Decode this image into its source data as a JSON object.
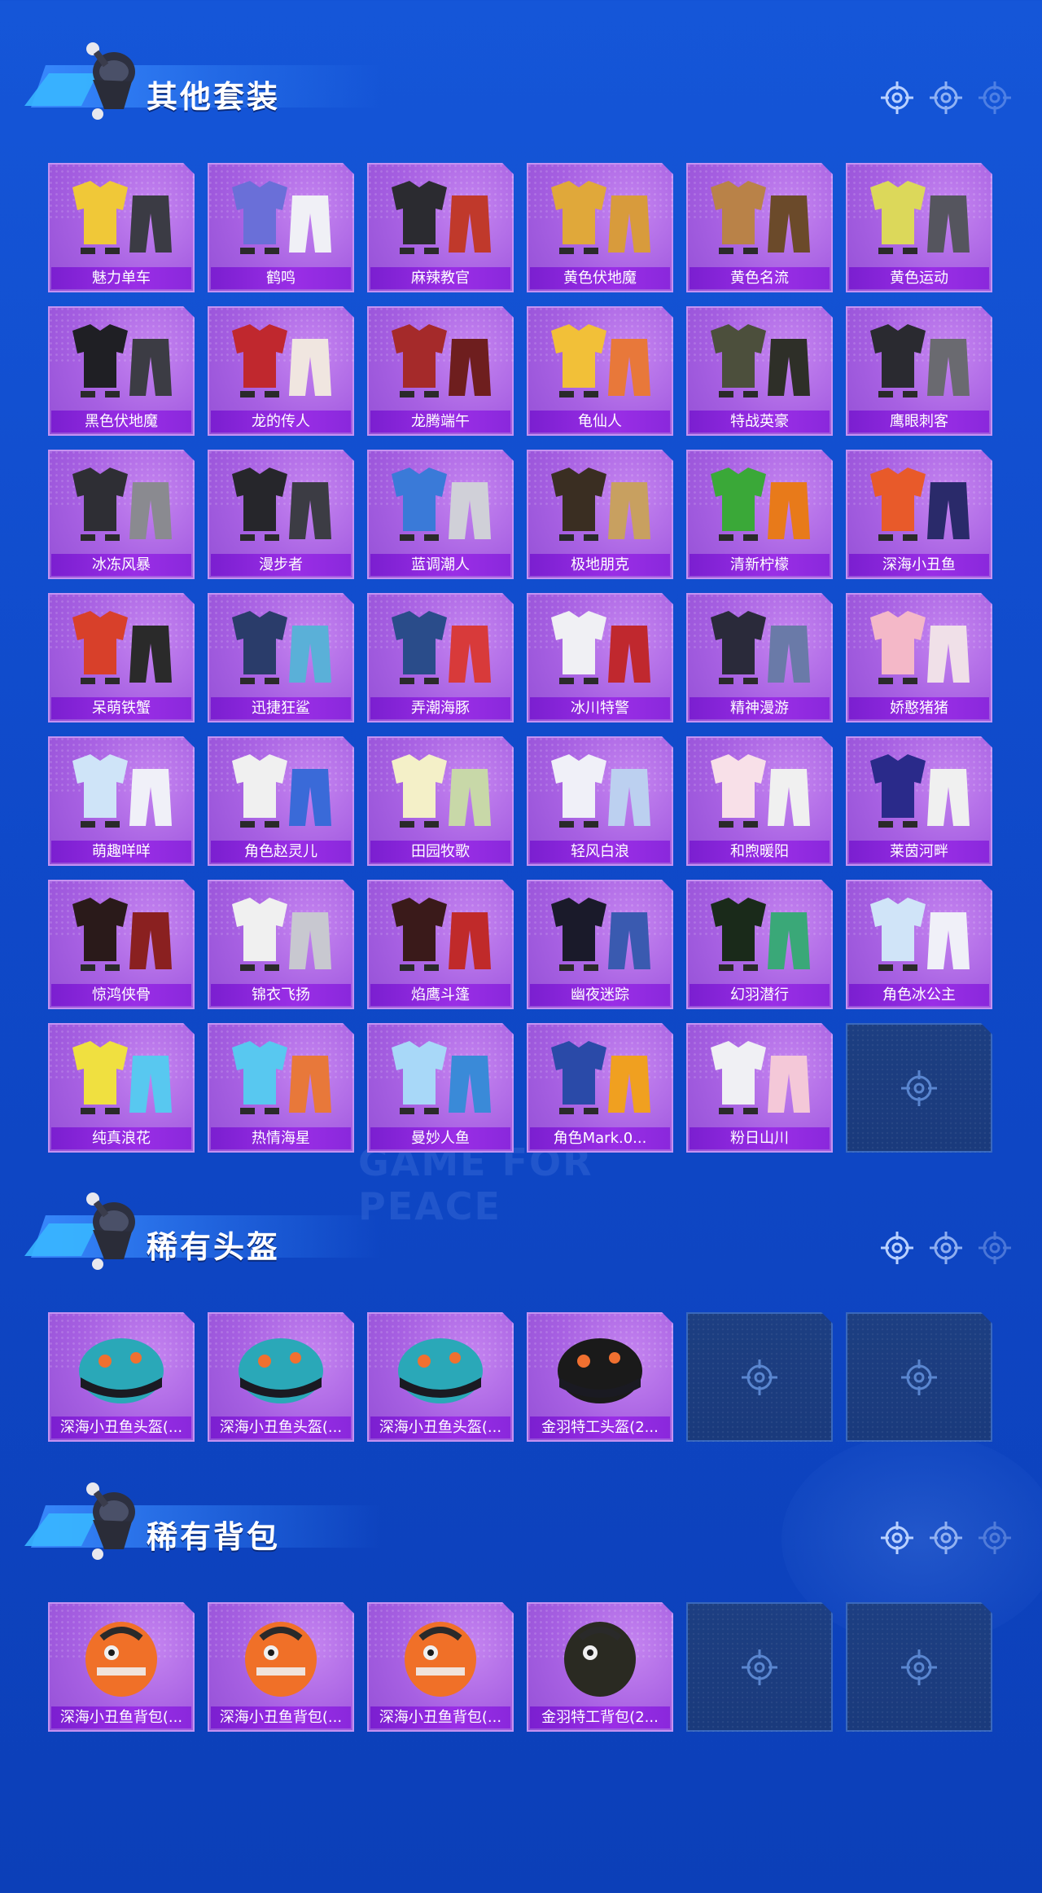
{
  "sections": [
    {
      "title": "其他套装",
      "items": [
        "魅力单车",
        "鹤鸣",
        "麻辣教官",
        "黄色伏地魔",
        "黄色名流",
        "黄色运动",
        "黑色伏地魔",
        "龙的传人",
        "龙腾端午",
        "龟仙人",
        "特战英豪",
        "鹰眼刺客",
        "冰冻风暴",
        "漫步者",
        "蓝调潮人",
        "极地朋克",
        "清新柠檬",
        "深海小丑鱼",
        "呆萌铁蟹",
        "迅捷狂鲨",
        "弄潮海豚",
        "冰川特警",
        "精神漫游",
        "娇憨猪猪",
        "萌趣咩咩",
        "角色赵灵儿",
        "田园牧歌",
        "轻风白浪",
        "和煦暖阳",
        "莱茵河畔",
        "惊鸿侠骨",
        "锦衣飞扬",
        "焰鹰斗篷",
        "幽夜迷踪",
        "幻羽潜行",
        "角色冰公主",
        "纯真浪花",
        "热情海星",
        "曼妙人鱼",
        "角色Mark.0...",
        "粉日山川"
      ],
      "empty_slots": 1
    },
    {
      "title": "稀有头盔",
      "items": [
        "深海小丑鱼头盔(...",
        "深海小丑鱼头盔(...",
        "深海小丑鱼头盔(...",
        "金羽特工头盔(2..."
      ],
      "empty_slots": 2
    },
    {
      "title": "稀有背包",
      "items": [
        "深海小丑鱼背包(...",
        "深海小丑鱼背包(...",
        "深海小丑鱼背包(...",
        "金羽特工背包(2..."
      ],
      "empty_slots": 2
    }
  ],
  "watermark": "GAME FOR PEACE",
  "colors": {
    "card_purple": "#a760e2",
    "label_purple": "#8a28dc",
    "empty_slot": "#1d3f82",
    "background": "#1250d0"
  }
}
